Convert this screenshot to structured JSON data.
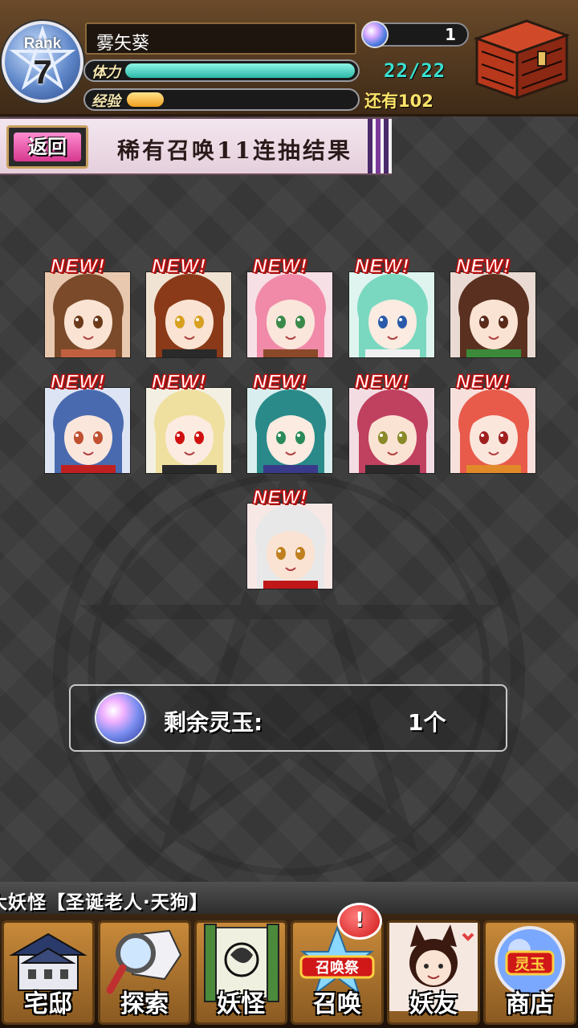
{
  "player": {
    "rank_word": "Rank",
    "rank": "7",
    "name": "雾矢葵",
    "stamina_label": "体力",
    "stamina_value": "22/22",
    "stamina_fraction": 1.0,
    "exp_label": "经验",
    "exp_fraction": 0.16,
    "exp_remaining": "还有102",
    "orb_count": "1"
  },
  "banner": {
    "back_label": "返回",
    "title": "稀有召唤11连抽结果"
  },
  "results": {
    "new_tag": "NEW!",
    "cards": [
      {
        "hair": "#7a4a2a",
        "bg": "#e8c9b0",
        "skin": "#fbe3d3",
        "eyes": "#6a3a1a",
        "accent": "#c06040"
      },
      {
        "hair": "#8a3a18",
        "bg": "#f1e3d3",
        "skin": "#fbe3d3",
        "eyes": "#d8a020",
        "accent": "#2a2a2a"
      },
      {
        "hair": "#f08aa8",
        "bg": "#f7dfe6",
        "skin": "#fbe6dc",
        "eyes": "#3a8a4a",
        "accent": "#8a4a2a"
      },
      {
        "hair": "#7ad8c0",
        "bg": "#dff4ef",
        "skin": "#fbebe0",
        "eyes": "#2a5aaa",
        "accent": "#f0f0f0"
      },
      {
        "hair": "#5a3020",
        "bg": "#e9dbd3",
        "skin": "#fbe3d3",
        "eyes": "#5a2a1a",
        "accent": "#3a8a3a"
      },
      {
        "hair": "#4a6ab0",
        "bg": "#dde4f3",
        "skin": "#fbe6dc",
        "eyes": "#c05030",
        "accent": "#c02020"
      },
      {
        "hair": "#f0e0a0",
        "bg": "#f3efe3",
        "skin": "#fbebe0",
        "eyes": "#d01010",
        "accent": "#2a2a2a"
      },
      {
        "hair": "#2a8a8a",
        "bg": "#d9eeee",
        "skin": "#fbebe0",
        "eyes": "#2a8a5a",
        "accent": "#3a3a8a"
      },
      {
        "hair": "#c04060",
        "bg": "#f3dde3",
        "skin": "#fbe3d3",
        "eyes": "#8a8a2a",
        "accent": "#2a2a2a"
      },
      {
        "hair": "#e85a4a",
        "bg": "#f7e0dc",
        "skin": "#fbe6dc",
        "eyes": "#a02020",
        "accent": "#e08a2a"
      },
      {
        "hair": "#e8e8e8",
        "bg": "#f7e8e6",
        "skin": "#fbe3d3",
        "eyes": "#c08020",
        "accent": "#c01818"
      }
    ]
  },
  "orbs": {
    "label": "剩余灵玉:",
    "value": "1个"
  },
  "ticker": {
    "text": "大妖怪【圣诞老人·天狗】"
  },
  "nav": {
    "items": [
      {
        "label": "宅邸",
        "icon": "mansion-icon"
      },
      {
        "label": "探索",
        "icon": "magnifier-map-icon"
      },
      {
        "label": "妖怪",
        "icon": "scroll-icon"
      },
      {
        "label": "召唤",
        "icon": "summon-festival-icon",
        "sublabel": "召唤祭"
      },
      {
        "label": "妖友",
        "icon": "fox-girl-icon"
      },
      {
        "label": "商店",
        "icon": "orb-shop-icon",
        "sublabel": "灵玉"
      }
    ],
    "alert": "!"
  }
}
